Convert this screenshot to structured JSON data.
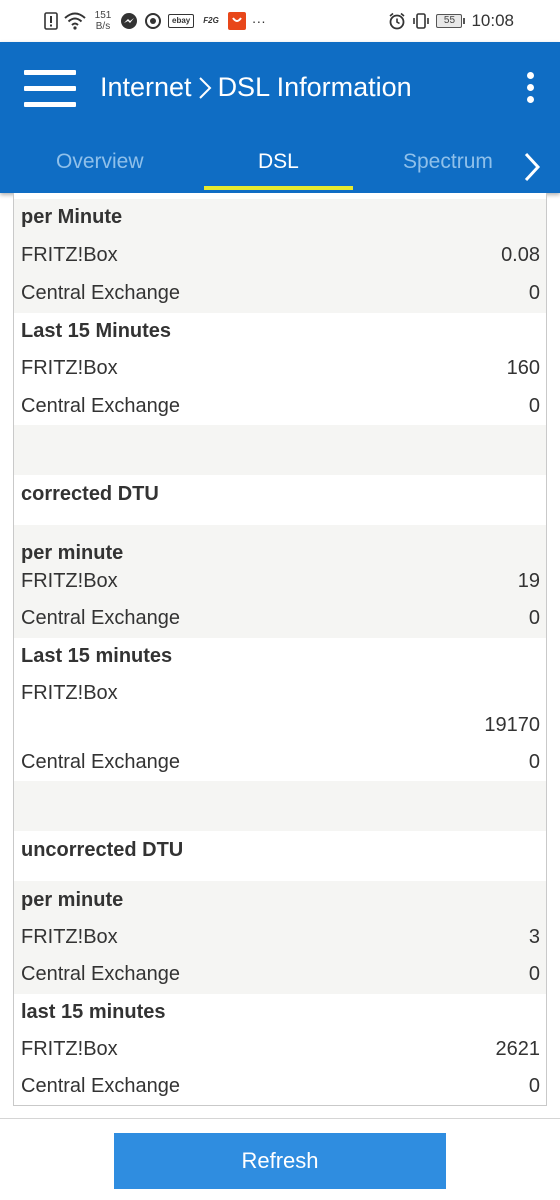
{
  "status_bar": {
    "speed_value": "151",
    "speed_unit": "B/s",
    "app_badges": [
      "ebay",
      "F2G"
    ],
    "more": "···",
    "battery": "55",
    "time": "10:08"
  },
  "app_bar": {
    "title_section": "Internet",
    "title_page": "DSL Information",
    "accent_color": "#0f6dc4",
    "tab_indicator_color": "#e6ea2e",
    "tabs": [
      {
        "label": "Overview",
        "active": false
      },
      {
        "label": "DSL",
        "active": true
      },
      {
        "label": "Spectrum",
        "active": false
      }
    ]
  },
  "rows": [
    {
      "label": "per Minute",
      "value": "",
      "header": true
    },
    {
      "label": "FRITZ!Box",
      "value": "0.08"
    },
    {
      "label": "Central Exchange",
      "value": "0"
    },
    {
      "label": "Last 15 Minutes",
      "value": "",
      "header": true
    },
    {
      "label": "FRITZ!Box",
      "value": "160"
    },
    {
      "label": "Central Exchange",
      "value": "0"
    },
    {
      "label": "",
      "value": ""
    },
    {
      "label": "corrected DTU",
      "value": "",
      "header": true
    },
    {
      "label": "",
      "value": ""
    },
    {
      "label": "per minute",
      "value": "",
      "header": true
    },
    {
      "label": "FRITZ!Box",
      "value": "19"
    },
    {
      "label": "Central Exchange",
      "value": "0"
    },
    {
      "label": "Last 15 minutes",
      "value": "",
      "header": true
    },
    {
      "label": "FRITZ!Box",
      "value": ""
    },
    {
      "label": "",
      "value": "19170"
    },
    {
      "label": "Central Exchange",
      "value": "0"
    },
    {
      "label": "",
      "value": ""
    },
    {
      "label": "uncorrected DTU",
      "value": "",
      "header": true
    },
    {
      "label": "",
      "value": ""
    },
    {
      "label": "per minute",
      "value": "",
      "header": true
    },
    {
      "label": "FRITZ!Box",
      "value": "3"
    },
    {
      "label": "Central Exchange",
      "value": "0"
    },
    {
      "label": "last 15 minutes",
      "value": "",
      "header": true
    },
    {
      "label": "FRITZ!Box",
      "value": "2621"
    },
    {
      "label": "Central Exchange",
      "value": "0"
    }
  ],
  "footer": {
    "refresh_label": "Refresh",
    "button_color": "#2f8de0"
  }
}
